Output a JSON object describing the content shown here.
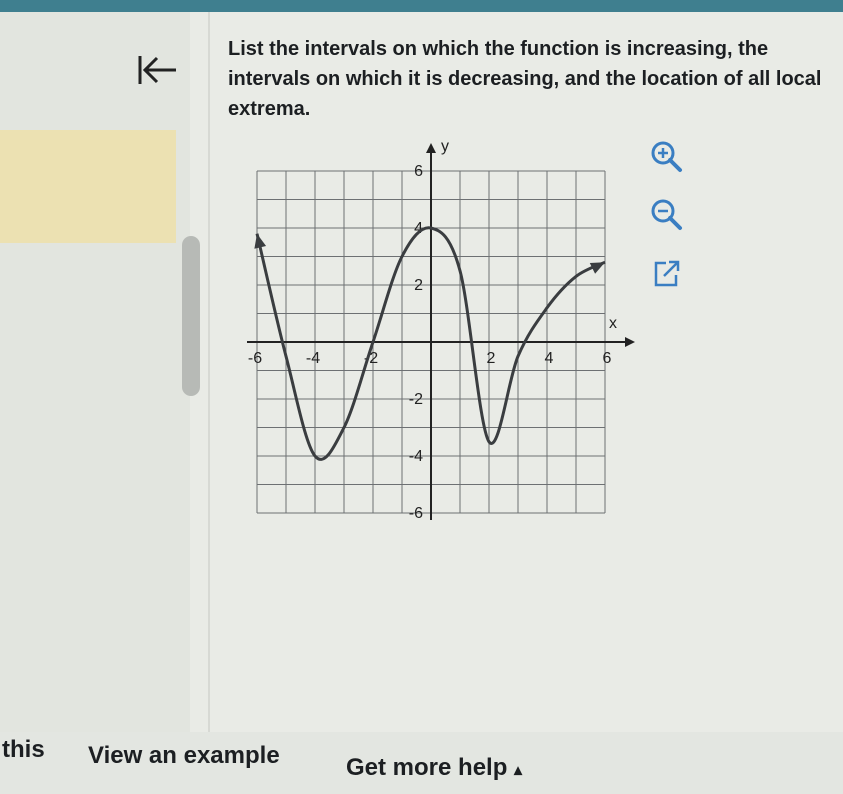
{
  "question": {
    "text": "List the intervals on which the function is increasing, the intervals on which it is decreasing, and the location of all local extrema."
  },
  "back_button": {
    "icon": "back-to-start-icon"
  },
  "graph": {
    "x_label": "x",
    "y_label": "y",
    "x_ticks": [
      -6,
      -4,
      -2,
      2,
      4,
      6
    ],
    "y_ticks": [
      6,
      4,
      2,
      -2,
      -4,
      -6
    ],
    "x_range": [
      -6,
      6
    ],
    "y_range": [
      -6,
      6
    ],
    "grid": true,
    "curve_points": [
      [
        -6,
        3.8
      ],
      [
        -5,
        -0.5
      ],
      [
        -4,
        -4
      ],
      [
        -3,
        -3
      ],
      [
        -2,
        0
      ],
      [
        -1,
        3
      ],
      [
        0,
        4
      ],
      [
        1,
        2.5
      ],
      [
        2,
        -3.5
      ],
      [
        3,
        -0.5
      ],
      [
        4,
        1.2
      ],
      [
        5,
        2.3
      ],
      [
        6,
        2.8
      ]
    ],
    "curve_color": "#3a3d40"
  },
  "tools": [
    {
      "icon": "zoom-in-icon"
    },
    {
      "icon": "zoom-out-icon"
    },
    {
      "icon": "pop-out-icon"
    }
  ],
  "footer": {
    "left_text": "this",
    "example_label": "View an example",
    "help_label": "Get more help",
    "help_arrow": "▴"
  },
  "colors": {
    "accent": "#3f7f8f",
    "highlight": "#ece1b2",
    "zoom_icon": "#3a7ec2"
  }
}
